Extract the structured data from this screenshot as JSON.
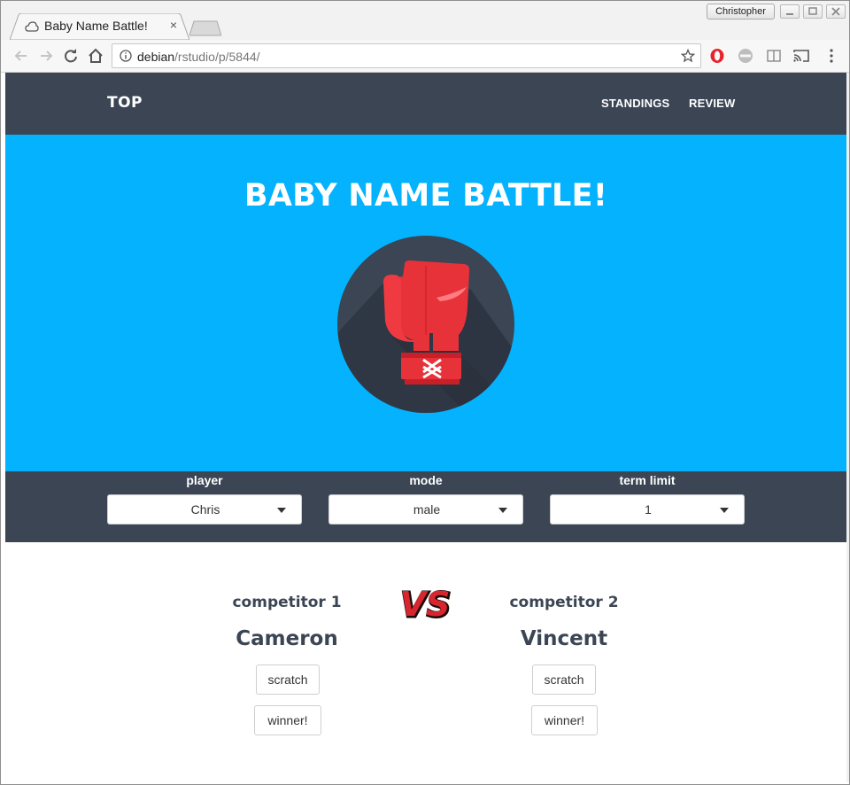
{
  "browser": {
    "tab_title": "Baby Name Battle!",
    "tab_close": "×",
    "profile_name": "Christopher",
    "url_host": "debian",
    "url_path": "/rstudio/p/5844/"
  },
  "nav": {
    "brand": "TOP",
    "links": [
      "STANDINGS",
      "REVIEW"
    ]
  },
  "hero": {
    "title": "BABY NAME BATTLE!"
  },
  "controls": [
    {
      "label": "player",
      "value": "Chris"
    },
    {
      "label": "mode",
      "value": "male"
    },
    {
      "label": "term limit",
      "value": "1"
    }
  ],
  "battle": {
    "vs_text": "VS",
    "competitors": [
      {
        "label": "competitor 1",
        "name": "Cameron",
        "scratch": "scratch",
        "winner": "winner!"
      },
      {
        "label": "competitor 2",
        "name": "Vincent",
        "scratch": "scratch",
        "winner": "winner!"
      }
    ]
  },
  "colors": {
    "nav_bg": "#3b4554",
    "hero_bg": "#04b2fd",
    "glove_red": "#e8323a",
    "text_dark": "#3b4554"
  }
}
